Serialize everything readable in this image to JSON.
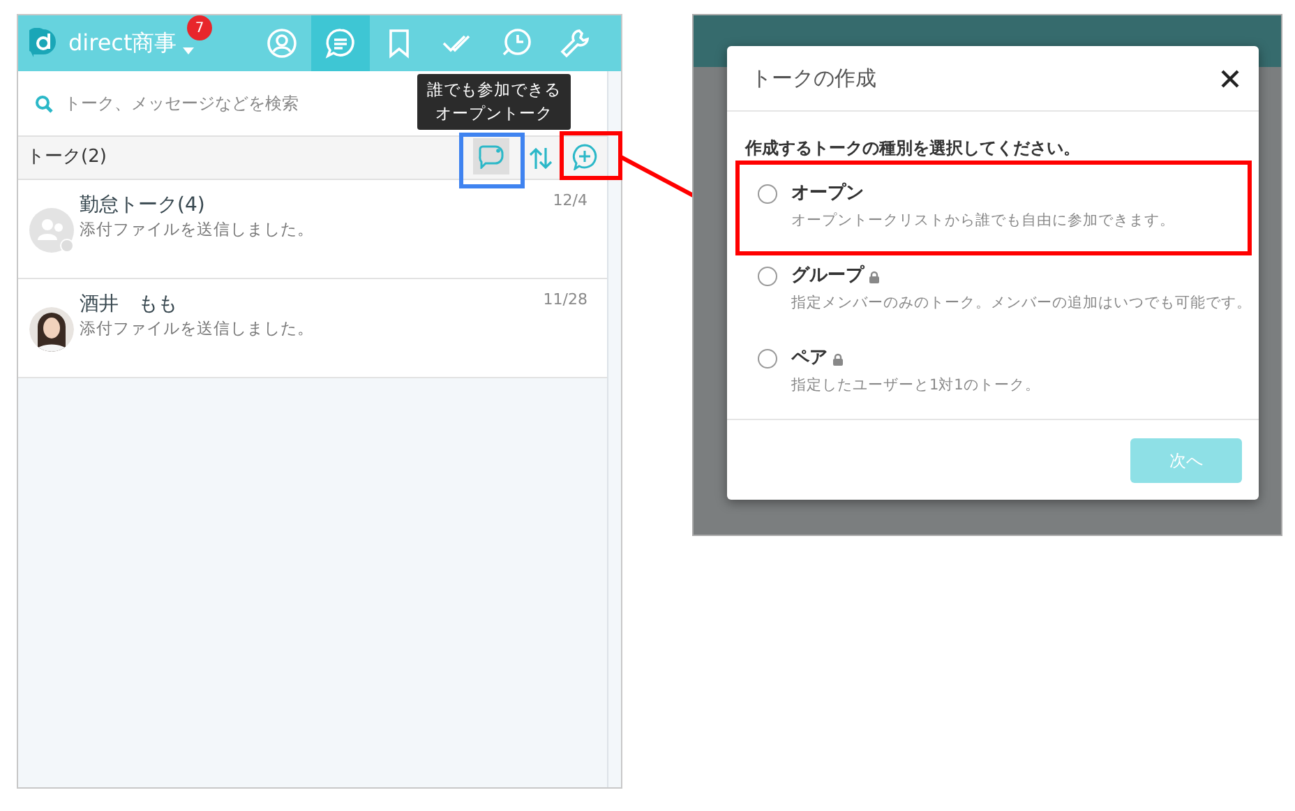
{
  "app": {
    "brand": "direct商事",
    "badge": "7",
    "tabs": [
      {
        "kind": "profile",
        "selected": false
      },
      {
        "kind": "talks",
        "selected": true
      },
      {
        "kind": "bookmark",
        "selected": false
      },
      {
        "kind": "tasks",
        "selected": false
      },
      {
        "kind": "history",
        "selected": false
      },
      {
        "kind": "settings",
        "selected": false
      }
    ],
    "search": {
      "placeholder": "トーク、メッセージなどを検索"
    },
    "tooltip": [
      "誰でも参加できる",
      "オープントーク"
    ],
    "section_title": "トーク(2)",
    "talks": [
      {
        "name": "勤怠トーク(4)",
        "preview": "添付ファイルを送信しました。",
        "date": "12/4",
        "kind": "group"
      },
      {
        "name": "酒井　もも",
        "preview": "添付ファイルを送信しました。",
        "date": "11/28"
      }
    ]
  },
  "dialog": {
    "title": "トークの作成",
    "prompt": "作成するトークの種別を選択してください。",
    "options": [
      {
        "label": "オープン",
        "description": "オープントークリストから誰でも自由に参加できます。",
        "locked": false,
        "selected": false
      },
      {
        "label": "グループ",
        "description": "指定メンバーのみのトーク。メンバーの追加はいつでも可能です。",
        "locked": true,
        "selected": false
      },
      {
        "label": "ペア",
        "description": "指定したユーザーと1対1のトーク。",
        "locked": true,
        "selected": false
      }
    ],
    "next_button": {
      "label": "次へ",
      "disabled": true
    }
  }
}
